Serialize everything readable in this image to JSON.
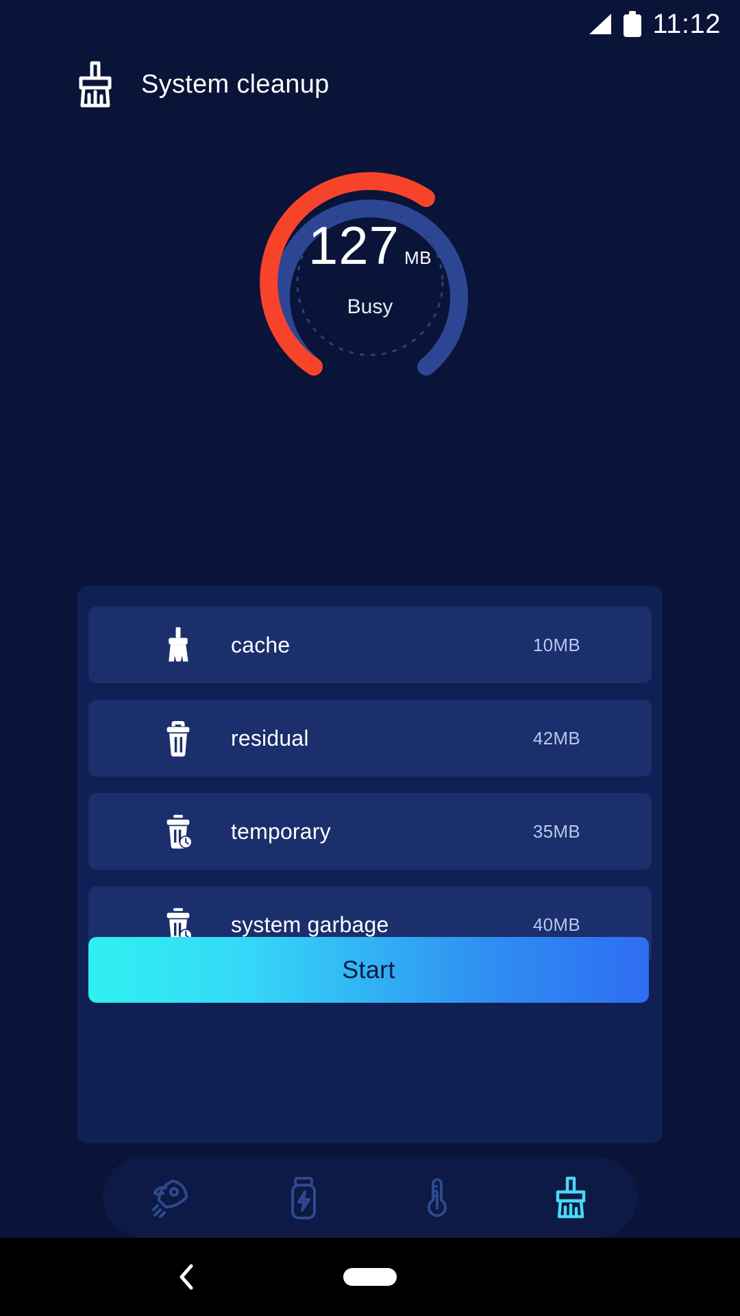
{
  "status_bar": {
    "time": "11:12",
    "signal_icon": "signal-triangle-icon",
    "battery_icon": "battery-full-icon"
  },
  "header": {
    "title": "System cleanup",
    "icon": "broom-icon"
  },
  "gauge": {
    "value": "127",
    "unit": "MB",
    "status": "Busy",
    "used_color": "#f8432b",
    "track_color": "#2d4694",
    "dotted_ring_color": "#2c4178",
    "used_ratio": 0.72
  },
  "cleanup_items": [
    {
      "icon": "broom-icon",
      "label": "cache",
      "size": "10MB"
    },
    {
      "icon": "trash-icon",
      "label": "residual",
      "size": "42MB"
    },
    {
      "icon": "trash-clock-icon",
      "label": "temporary",
      "size": "35MB"
    },
    {
      "icon": "trash-clock-icon",
      "label": "system garbage",
      "size": "40MB"
    }
  ],
  "action": {
    "start_label": "Start",
    "gradient_from": "#2ff0f0",
    "gradient_to": "#2f6df2"
  },
  "bottom_nav": [
    {
      "icon": "rocket-icon",
      "active": false
    },
    {
      "icon": "battery-bolt-icon",
      "active": false
    },
    {
      "icon": "thermometer-icon",
      "active": false
    },
    {
      "icon": "broom-icon",
      "active": true
    }
  ],
  "system_bar": {
    "back_icon": "chevron-left-icon",
    "home_icon": "home-pill-icon"
  },
  "theme": {
    "background": "#0a1438",
    "panel": "#102054",
    "row": "#1b2f6d",
    "accent_cyan": "#3ce0f0",
    "size_text": "#b8c8ef"
  }
}
